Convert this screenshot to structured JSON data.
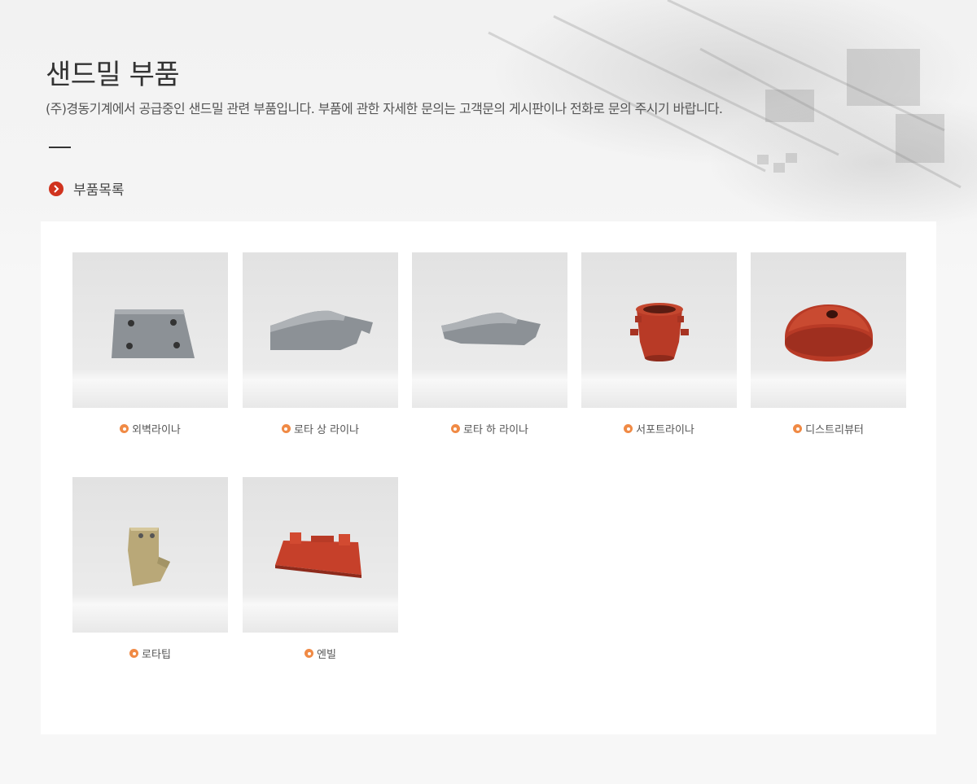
{
  "page": {
    "title": "샌드밀 부품",
    "description": "(주)경동기계에서 공급중인 샌드밀  관련  부품입니다. 부품에 관한 자세한 문의는 고객문의 게시판이나 전화로 문의 주시기 바랍니다.",
    "section_label": "부품목록"
  },
  "products": [
    {
      "name": "외벽라이나",
      "image": "outer-wall-liner"
    },
    {
      "name": "로타 상 라이나",
      "image": "rotor-upper-liner"
    },
    {
      "name": "로타 하 라이나",
      "image": "rotor-lower-liner"
    },
    {
      "name": "서포트라이나",
      "image": "support-liner"
    },
    {
      "name": "디스트리뷰터",
      "image": "distributor"
    },
    {
      "name": "로타팁",
      "image": "rotor-tip"
    },
    {
      "name": "엔빌",
      "image": "anvil"
    }
  ],
  "colors": {
    "accent_red": "#d0331e",
    "bullet_orange": "#f08a45",
    "red_part": "#b83a26",
    "steel_part": "#8c9196",
    "brass_part": "#b9a878"
  }
}
